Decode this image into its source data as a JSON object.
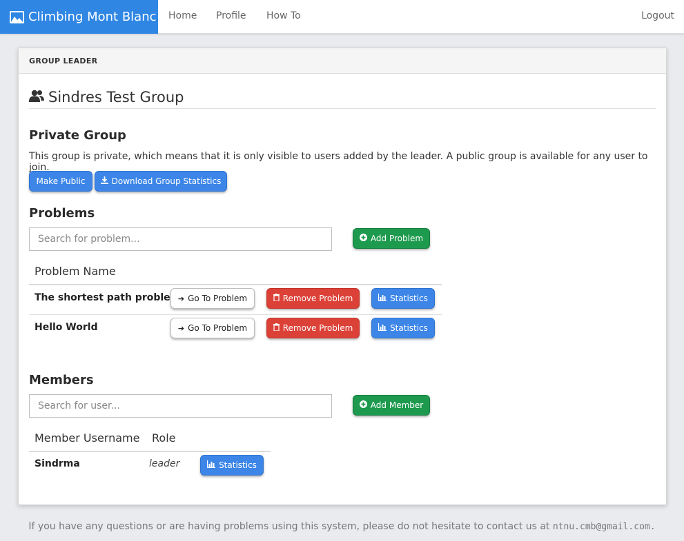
{
  "navbar": {
    "brand": "Climbing Mont Blanc",
    "brand_icon": "image-icon",
    "links": [
      "Home",
      "Profile",
      "How To"
    ],
    "logout": "Logout",
    "brand_color": "#2f86e3"
  },
  "card": {
    "header": "GROUP LEADER",
    "group_name": "Sindres Test Group",
    "privacy": {
      "heading": "Private Group",
      "description": "This group is private, which means that it is only visible to users added by the leader. A public group is available for any user to join.",
      "make_public": "Make Public",
      "download_stats": "Download Group Statistics"
    },
    "problems": {
      "heading": "Problems",
      "search_placeholder": "Search for problem...",
      "add_button": "Add Problem",
      "column_header": "Problem Name",
      "rows": [
        {
          "name": "The shortest path problem",
          "go": "Go To Problem",
          "remove": "Remove Problem",
          "stats": "Statistics"
        },
        {
          "name": "Hello World",
          "go": "Go To Problem",
          "remove": "Remove Problem",
          "stats": "Statistics"
        }
      ]
    },
    "members": {
      "heading": "Members",
      "search_placeholder": "Search for user...",
      "add_button": "Add Member",
      "columns": [
        "Member Username",
        "Role"
      ],
      "rows": [
        {
          "username": "Sindrma",
          "role": "leader",
          "stats": "Statistics"
        }
      ]
    }
  },
  "footer": {
    "text": "If you have any questions or are having problems using this system, please do not hesitate to contact us at",
    "email": "ntnu.cmb@gmail.com",
    "suffix": "."
  }
}
